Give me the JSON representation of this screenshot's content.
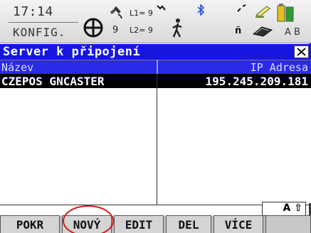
{
  "status": {
    "time": "17:14",
    "mode": "KONFIG.",
    "sat_count": "9",
    "l1": "L1= 9",
    "l2": "L2= 9",
    "kbd_mode": "A B"
  },
  "dialog": {
    "title": "Server k připojení",
    "columns": [
      "Název",
      "IP Adresa"
    ]
  },
  "rows": [
    {
      "name": "CZEPOS GNCASTER",
      "ip": "195.245.209.181",
      "selected": true
    }
  ],
  "input_mode": "A ⇧",
  "softkeys": [
    "POKR",
    "NOVÝ",
    "EDIT",
    "DEL",
    "VÍCE"
  ],
  "colors": {
    "title_bg": "#1616e0",
    "header_bg": "#2a2ae8",
    "highlight_ring": "#cc1a1a"
  }
}
